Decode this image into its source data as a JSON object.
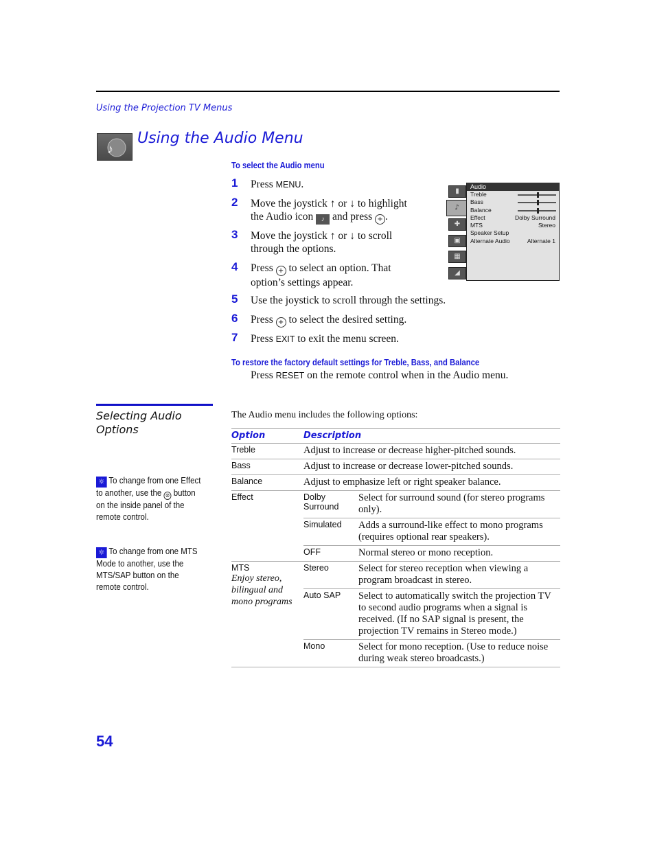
{
  "running_head": "Using the Projection TV Menus",
  "page_title": "Using the Audio Menu",
  "select_section": {
    "heading": "To select the Audio menu",
    "steps": [
      {
        "num": "1",
        "parts": [
          "Press ",
          "MENU",
          "."
        ]
      },
      {
        "num": "2",
        "line1": "Move the joystick ↑ or ↓ to highlight",
        "line2a": "the Audio icon",
        "line2b": "and press",
        "line2c": "."
      },
      {
        "num": "3",
        "line1": "Move the joystick ↑ or ↓ to scroll",
        "line2": "through the options."
      },
      {
        "num": "4",
        "line1a": "Press",
        "line1b": "to select an option. That",
        "line2": "option’s settings appear."
      },
      {
        "num": "5",
        "text": "Use the joystick to scroll through the settings."
      },
      {
        "num": "6",
        "a": "Press",
        "b": "to select the desired setting."
      },
      {
        "num": "7",
        "a": "Press ",
        "key": "EXIT",
        "b": " to exit the menu screen."
      }
    ]
  },
  "restore_section": {
    "heading": "To restore the factory default settings for Treble, Bass, and Balance",
    "a": "Press ",
    "key": "RESET",
    "b": " on the remote control when in the Audio menu."
  },
  "osd": {
    "title": "Audio",
    "rows": [
      {
        "label": "Treble",
        "slider": 0.5
      },
      {
        "label": "Bass",
        "slider": 0.5
      },
      {
        "label": "Balance",
        "slider": 0.5
      },
      {
        "label": "Effect",
        "value": "Dolby Surround"
      },
      {
        "label": "MTS",
        "value": "Stereo"
      },
      {
        "label": "Speaker Setup",
        "value": ""
      },
      {
        "label": "Alternate Audio",
        "value": "Alternate 1"
      }
    ],
    "side_icons": [
      "video-icon",
      "audio-icon",
      "setup-icon",
      "channel-icon",
      "parental-icon",
      "timer-icon"
    ]
  },
  "sidebar": {
    "section_title_1": "Selecting Audio",
    "section_title_2": "Options",
    "tip1": {
      "a": "To change from one Effect to another, use the",
      "b": "button on the inside panel of the remote control."
    },
    "tip2": "To change from one MTS Mode to another, use the MTS/SAP button on the remote control."
  },
  "intro": "The Audio menu includes the following options:",
  "table": {
    "headers": [
      "Option",
      "Description"
    ],
    "simple_rows": [
      {
        "option": "Treble",
        "desc": "Adjust to increase or decrease higher-pitched sounds."
      },
      {
        "option": "Bass",
        "desc": "Adjust to increase or decrease lower-pitched sounds."
      },
      {
        "option": "Balance",
        "desc": "Adjust to emphasize left or right speaker balance."
      }
    ],
    "effect": {
      "option": "Effect",
      "settings": [
        {
          "name": "Dolby Surround",
          "desc": "Select for surround sound (for stereo programs only)."
        },
        {
          "name": "Simulated",
          "desc": "Adds a surround-like effect to mono programs (requires optional rear speakers)."
        },
        {
          "name": "OFF",
          "desc": "Normal stereo or mono reception."
        }
      ]
    },
    "mts": {
      "option": "MTS",
      "note": "Enjoy stereo, bilingual and mono programs",
      "settings": [
        {
          "name": "Stereo",
          "desc": "Select for stereo reception when viewing a program broadcast in stereo."
        },
        {
          "name": "Auto SAP",
          "desc": "Select to automatically switch the projection TV to second audio programs when a signal is received. (If no SAP signal is present, the projection TV remains in Stereo mode.)"
        },
        {
          "name": "Mono",
          "desc": "Select for mono reception. (Use to reduce noise during weak stereo broadcasts.)"
        }
      ]
    }
  },
  "page_number": "54"
}
